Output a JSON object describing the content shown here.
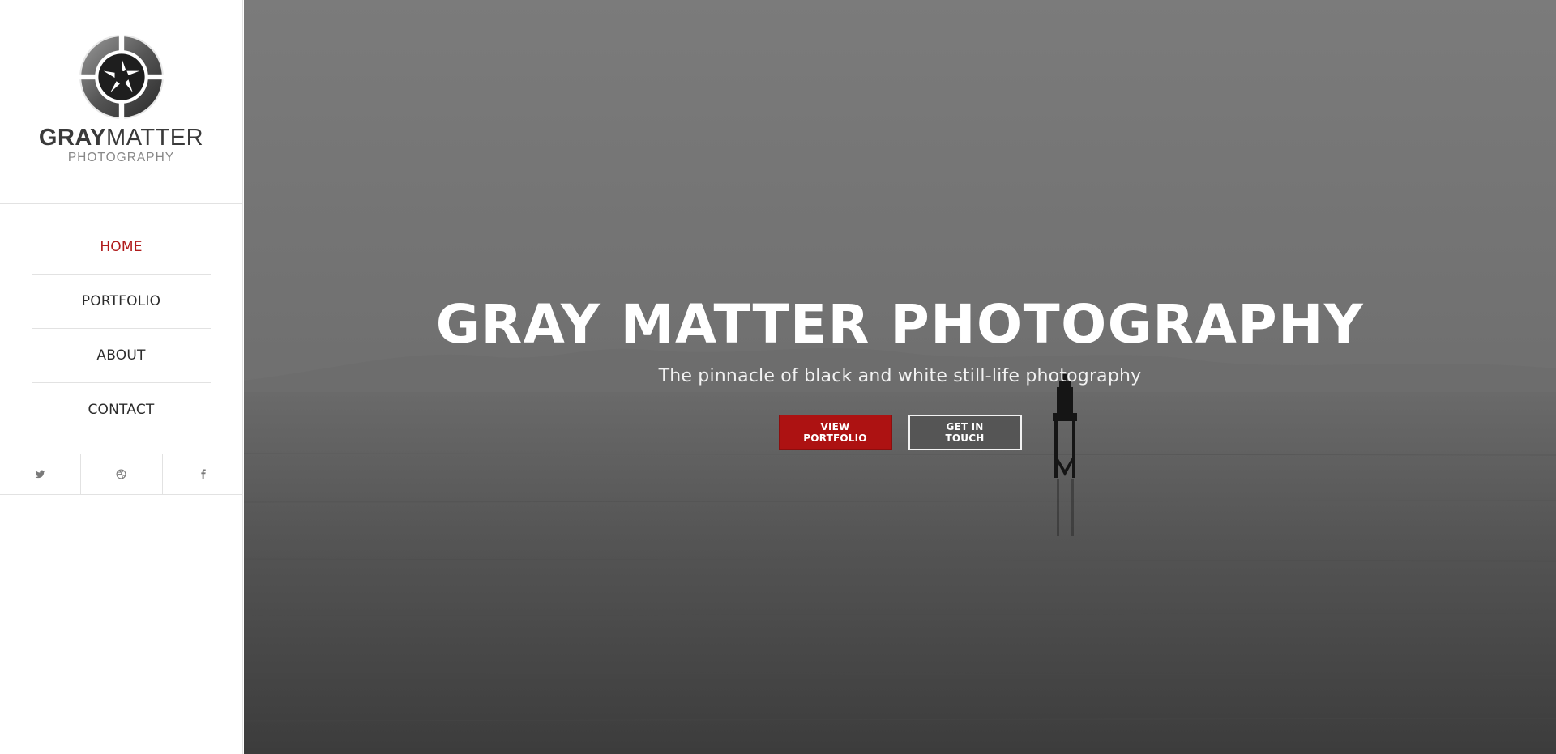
{
  "logo": {
    "name_bold": "GRAY",
    "name_light": "MATTER",
    "tagline": "PHOTOGRAPHY"
  },
  "nav": {
    "items": [
      {
        "label": "HOME",
        "active": true
      },
      {
        "label": "PORTFOLIO",
        "active": false
      },
      {
        "label": "ABOUT",
        "active": false
      },
      {
        "label": "CONTACT",
        "active": false
      }
    ]
  },
  "social": [
    {
      "icon": "twitter-icon"
    },
    {
      "icon": "dribbble-icon"
    },
    {
      "icon": "facebook-icon"
    }
  ],
  "hero": {
    "title": "GRAY MATTER PHOTOGRAPHY",
    "subtitle": "The pinnacle of black and white still-life photography",
    "primary_button": "VIEW PORTFOLIO",
    "secondary_button": "GET IN TOUCH"
  },
  "colors": {
    "accent": "#ad1212",
    "nav_active": "#b01c1c",
    "sidebar_bg": "#ffffff"
  }
}
